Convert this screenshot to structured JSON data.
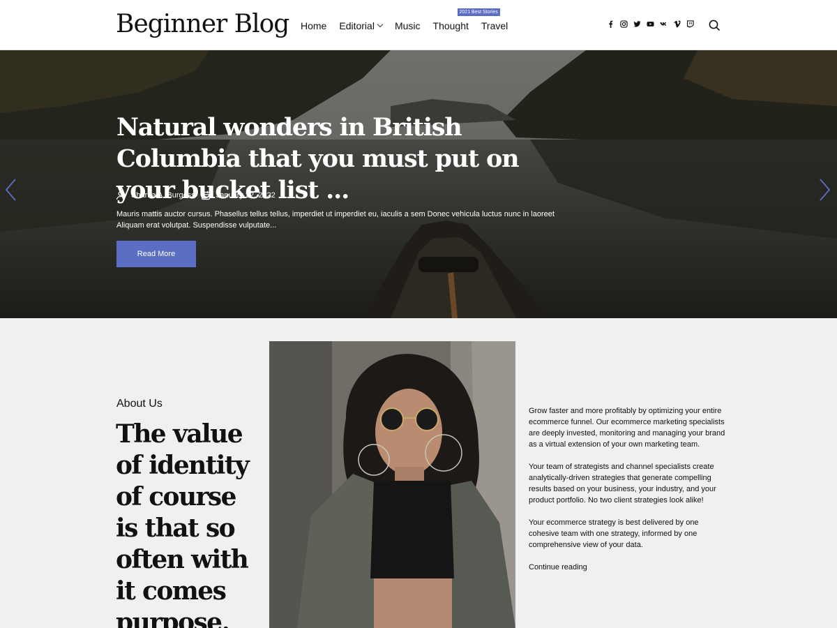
{
  "header": {
    "logo": "Beginner Blog",
    "nav": [
      {
        "label": "Home"
      },
      {
        "label": "Editorial",
        "has_dropdown": true
      },
      {
        "label": "Music"
      },
      {
        "label": "Thought",
        "badge": "2021 Best Stories"
      },
      {
        "label": "Travel"
      }
    ],
    "social_icons": [
      "facebook-icon",
      "instagram-icon",
      "twitter-icon",
      "youtube-icon",
      "vk-icon",
      "vimeo-icon",
      "twitch-icon"
    ],
    "search_icon": "search-icon"
  },
  "hero": {
    "title": "Natural wonders in British Columbia that you must put on your bucket list ...",
    "author": "Sharna A. Burgess",
    "date": "January 22, 2022",
    "excerpt": "Mauris mattis auctor cursus. Phasellus tellus tellus, imperdiet ut imperdiet eu, iaculis a sem Donec vehicula luctus nunc in laoreet Aliquam erat volutpat. Suspendisse vulputate...",
    "button": "Read More",
    "prev_icon": "chevron-left-icon",
    "next_icon": "chevron-right-icon"
  },
  "about": {
    "label": "About Us",
    "heading": "The value of identity of course is that so often with it comes purpose.",
    "paragraphs": [
      "Grow faster and more profitably by optimizing your entire ecommerce funnel. Our ecommerce marketing specialists are deeply invested, monitoring and managing your brand as a virtual extension of your own marketing team.",
      "Your team of strategists and channel specialists create analytically-driven strategies that generate compelling results based on your business, your industry, and your product portfolio. No two client strategies look alike!",
      "Your ecommerce strategy is best delivered by one cohesive team with one strategy, informed by one comprehensive view of your data."
    ],
    "continue": "Continue reading"
  },
  "colors": {
    "accent": "#5b6ec4",
    "header_bg": "#ffffff",
    "page_bg": "#f0f0f0",
    "text": "#111111"
  }
}
